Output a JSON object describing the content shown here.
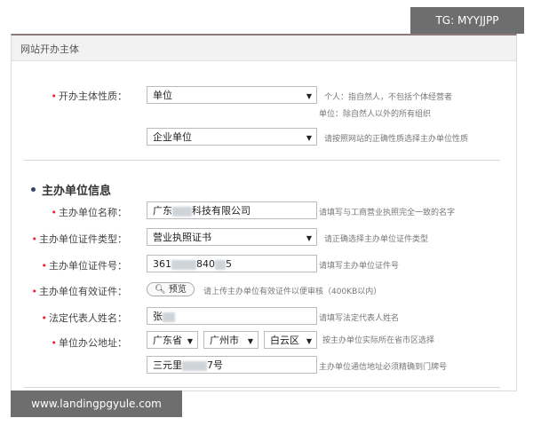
{
  "watermark_tag": "TG: MYYJJPP",
  "footer_url": "www.landingpgyule.com",
  "panel": {
    "title": "网站开办主体"
  },
  "subject": {
    "nature_label": "开办主体性质：",
    "nature_value": "单位",
    "nature_hint_1": "个人：指自然人，不包括个体经营者",
    "nature_hint_2": "单位：除自然人以外的所有组织",
    "unit_type_value": "企业单位",
    "unit_type_hint": "请按照网站的正确性质选择主办单位性质"
  },
  "org": {
    "section_title": "主办单位信息",
    "name_label": "主办单位名称：",
    "name_value_pre": "广东",
    "name_value_post": "科技有限公司",
    "name_hint": "请填写与工商营业执照完全一致的名字",
    "cert_type_label": "主办单位证件类型：",
    "cert_type_value": "营业执照证书",
    "cert_type_hint": "请正确选择主办单位证件类型",
    "cert_no_label": "主办单位证件号：",
    "cert_no_pre": "361",
    "cert_no_mid": "840",
    "cert_no_post": "5",
    "cert_no_hint": "请填写主办单位证件号",
    "cert_file_label": "主办单位有效证件：",
    "preview_button": "预览",
    "cert_file_hint": "请上传主办单位有效证件以便审核（400KB以内）",
    "legal_label": "法定代表人姓名：",
    "legal_value_pre": "张",
    "legal_hint": "请填写法定代表人姓名",
    "address_label": "单位办公地址：",
    "province": "广东省",
    "city": "广州市",
    "district": "白云区",
    "address_hint": "按主办单位实际所在省市区选择",
    "street_pre": "三元里",
    "street_post": "7号",
    "street_hint": "主办单位通信地址必须精确到门牌号"
  },
  "icons": {
    "dropdown": "chevron-down-icon",
    "search": "search-icon"
  }
}
